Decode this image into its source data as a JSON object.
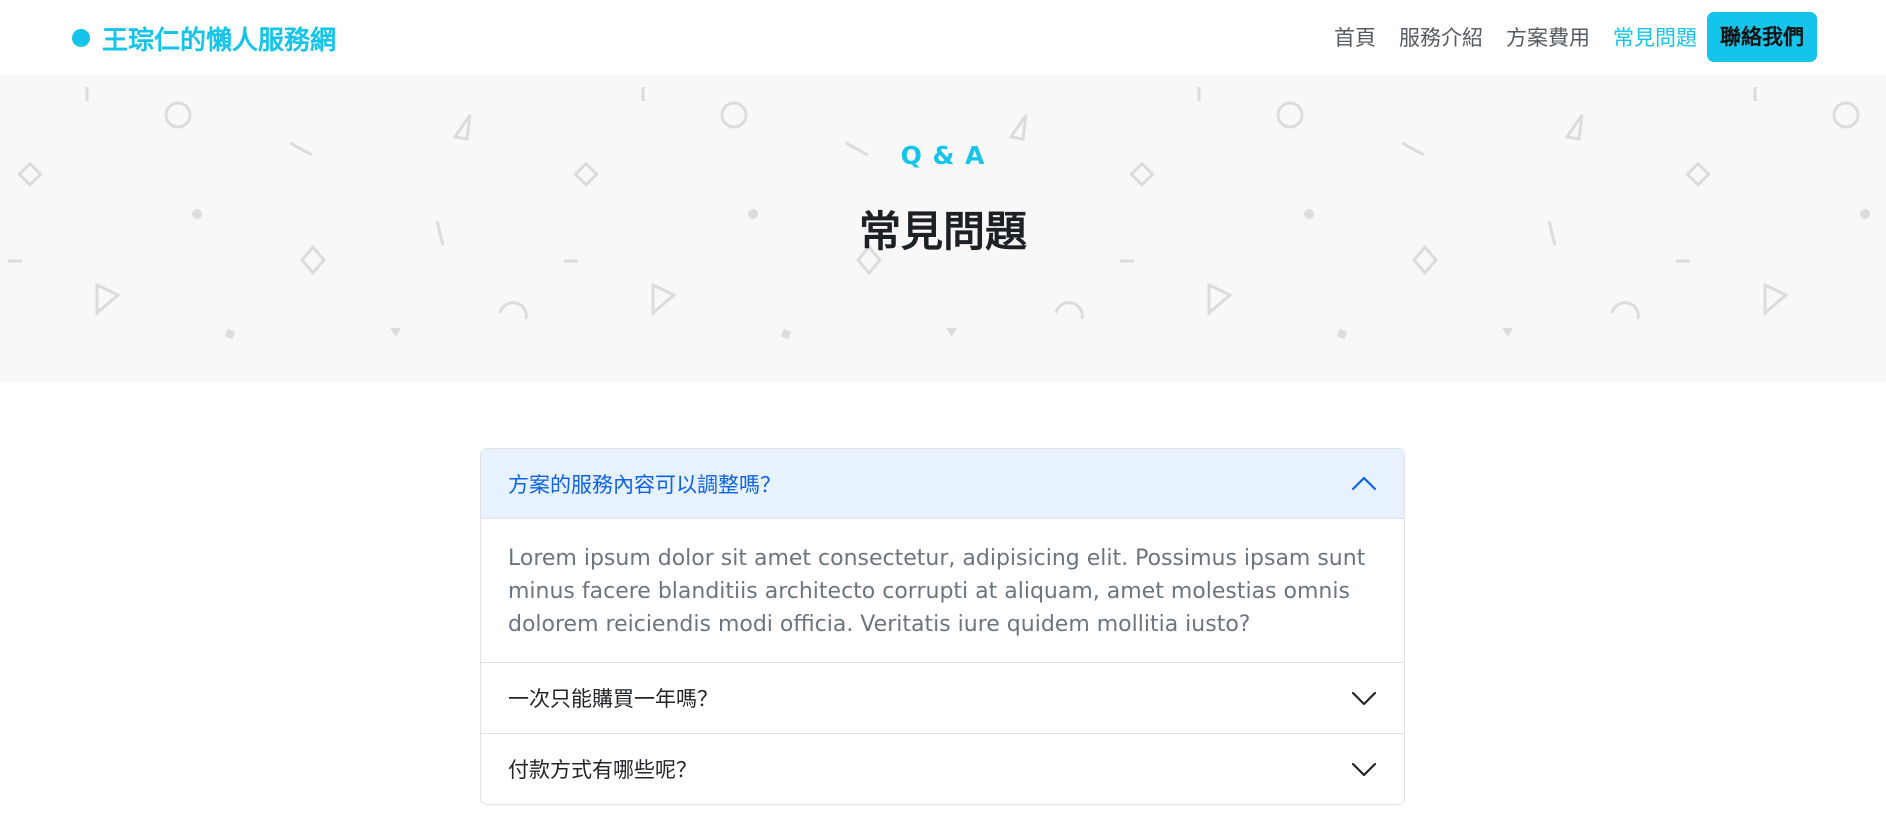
{
  "navbar": {
    "brand": "王琮仁的懶人服務網",
    "links": [
      {
        "label": "首頁",
        "active": false
      },
      {
        "label": "服務介紹",
        "active": false
      },
      {
        "label": "方案費用",
        "active": false
      },
      {
        "label": "常見問題",
        "active": true
      }
    ],
    "cta": "聯絡我們"
  },
  "hero": {
    "subtitle": "Q & A",
    "title": "常見問題"
  },
  "faq": [
    {
      "question": "方案的服務內容可以調整嗎？",
      "answer": "Lorem ipsum dolor sit amet consectetur, adipisicing elit. Possimus ipsam sunt minus facere blanditiis architecto corrupti at aliquam, amet molestias omnis dolorem reiciendis modi officia. Veritatis iure quidem mollitia iusto?",
      "expanded": true
    },
    {
      "question": "一次只能購買一年嗎？",
      "expanded": false
    },
    {
      "question": "付款方式有哪些呢？",
      "expanded": false
    }
  ],
  "colors": {
    "accent": "#14c4ea",
    "accordion_active_bg": "#e7f1ff",
    "accordion_active_text": "#0c63e4",
    "hero_bg": "#f8f8f8"
  },
  "icons": {
    "expanded": "chevron-up-icon",
    "collapsed": "chevron-down-icon"
  }
}
